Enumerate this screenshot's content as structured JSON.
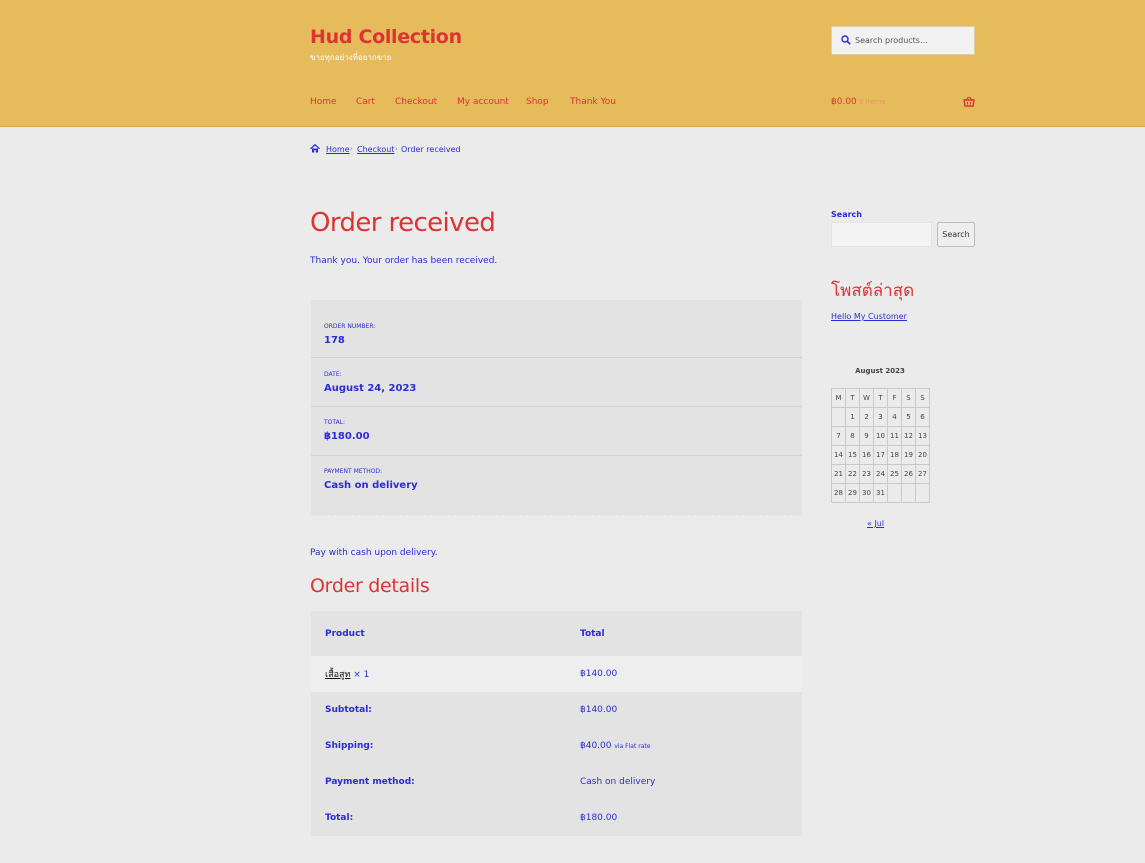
{
  "header": {
    "site_title": "Hud Collection",
    "tagline": "ขายทุกอย่างที่อยากขาย",
    "search_placeholder": "Search products…",
    "nav": [
      "Home",
      "Cart",
      "Checkout",
      "My account",
      "Shop",
      "Thank You"
    ],
    "cart_amount": "฿0.00",
    "cart_count": "0 items"
  },
  "breadcrumb": {
    "home": "Home",
    "checkout": "Checkout",
    "current": "Order received"
  },
  "main": {
    "title": "Order received",
    "thank_you": "Thank you. Your order has been received.",
    "overview": [
      {
        "label": "Order number:",
        "value": "178"
      },
      {
        "label": "Date:",
        "value": "August 24, 2023"
      },
      {
        "label": "Total:",
        "value": "฿180.00"
      },
      {
        "label": "Payment method:",
        "value": "Cash on delivery"
      }
    ],
    "pay_note": "Pay with cash upon delivery.",
    "details_title": "Order details",
    "table": {
      "header": {
        "product": "Product",
        "total": "Total"
      },
      "item": {
        "name": "เสื้อสูท",
        "qty": "× 1",
        "total": "฿140.00"
      },
      "subtotal": {
        "label": "Subtotal:",
        "value": "฿140.00"
      },
      "shipping": {
        "label": "Shipping:",
        "value": "฿40.00",
        "via": "via Flat rate"
      },
      "payment": {
        "label": "Payment method:",
        "value": "Cash on delivery"
      },
      "total": {
        "label": "Total:",
        "value": "฿180.00"
      }
    }
  },
  "sidebar": {
    "search_label": "Search",
    "search_button": "Search",
    "recent_title": "โพสต์ล่าสุด",
    "recent_post": "Hello My Customer",
    "calendar": {
      "caption": "August 2023",
      "days": [
        "M",
        "T",
        "W",
        "T",
        "F",
        "S",
        "S"
      ],
      "weeks": [
        [
          "",
          "1",
          "2",
          "3",
          "4",
          "5",
          "6"
        ],
        [
          "7",
          "8",
          "9",
          "10",
          "11",
          "12",
          "13"
        ],
        [
          "14",
          "15",
          "16",
          "17",
          "18",
          "19",
          "20"
        ],
        [
          "21",
          "22",
          "23",
          "24",
          "25",
          "26",
          "27"
        ],
        [
          "28",
          "29",
          "30",
          "31",
          "",
          "",
          ""
        ]
      ],
      "prev": "« Jul"
    }
  },
  "colors": {
    "header_bg": "#e6bb5c",
    "accent": "#dd3333",
    "link": "#2b2bd8",
    "page_bg": "#ebebeb"
  }
}
